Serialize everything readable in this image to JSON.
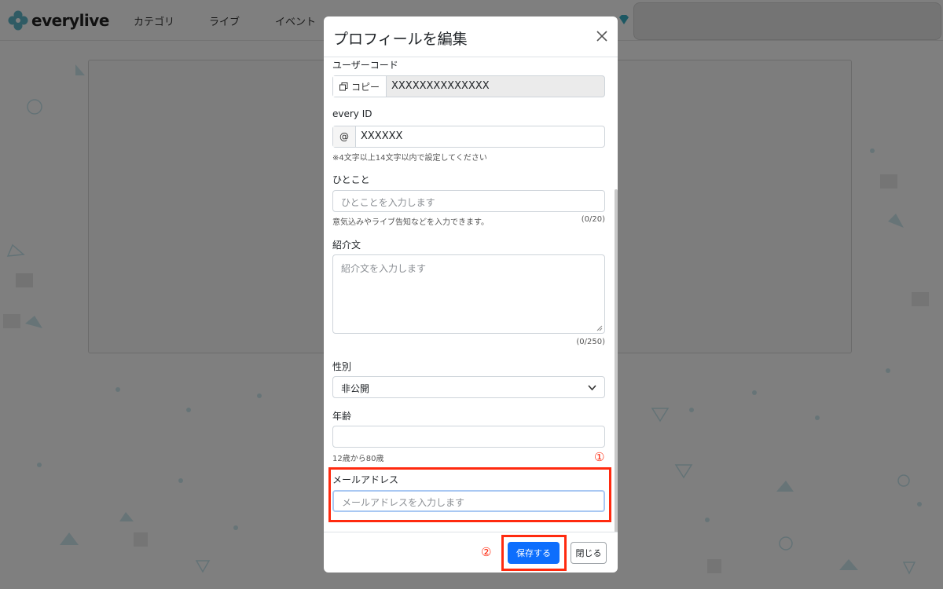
{
  "header": {
    "logo_text": "everylive",
    "nav": [
      "カテゴリ",
      "ライブ",
      "イベント"
    ]
  },
  "modal": {
    "title": "プロフィールを編集",
    "user_code": {
      "label": "ユーザーコード",
      "copy_label": "コピー",
      "value": "XXXXXXXXXXXXXX"
    },
    "every_id": {
      "label": "every ID",
      "prefix": "@",
      "value": "XXXXXX",
      "help": "※4文字以上14文字以内で設定してください"
    },
    "hitokoto": {
      "label": "ひとこと",
      "placeholder": "ひとことを入力します",
      "help": "意気込みやライブ告知などを入力できます。",
      "count": "(0/20)"
    },
    "intro": {
      "label": "紹介文",
      "placeholder": "紹介文を入力します",
      "count": "(0/250)"
    },
    "gender": {
      "label": "性別",
      "value": "非公開"
    },
    "age": {
      "label": "年齢",
      "help": "12歳から80歳"
    },
    "email": {
      "label": "メールアドレス",
      "placeholder": "メールアドレスを入力します"
    },
    "markers": {
      "one": "①",
      "two": "②"
    },
    "footer": {
      "save_label": "保存する",
      "close_label": "閉じる"
    }
  },
  "colors": {
    "accent": "#0d6efd",
    "highlight": "#ff2a0f",
    "brand": "#5fb7c9"
  }
}
